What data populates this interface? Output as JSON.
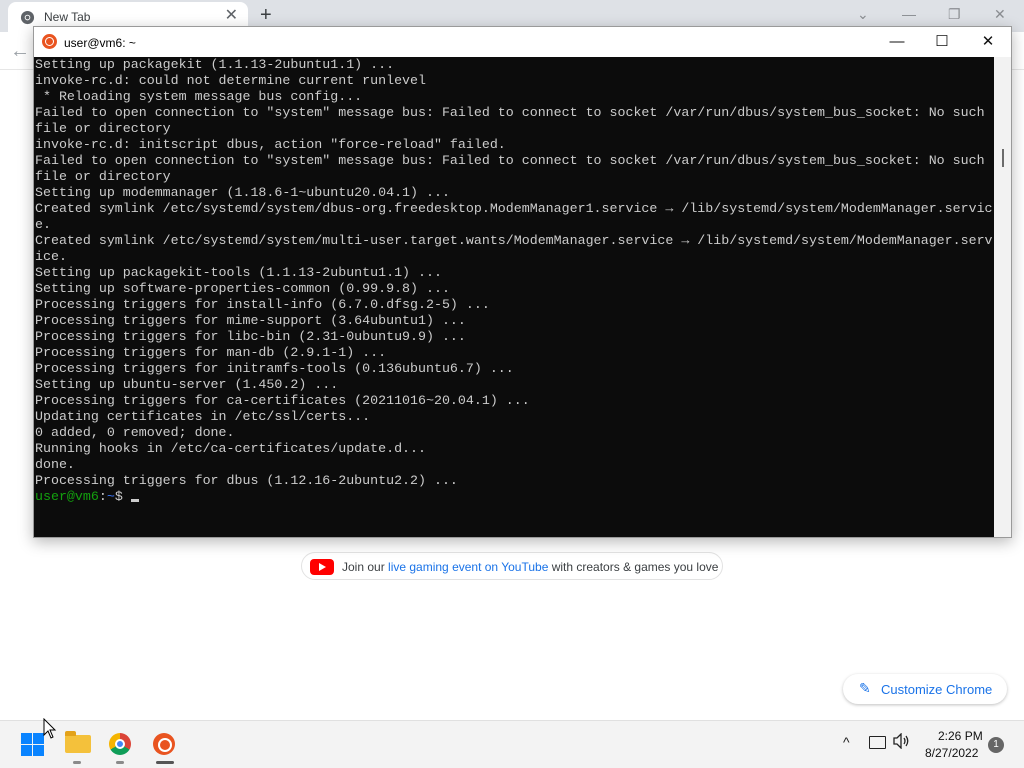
{
  "chrome": {
    "tab_title": "New Tab",
    "tab_close": "✕",
    "new_tab": "+",
    "controls": {
      "tabsearch": "⌄",
      "minimize": "—",
      "restore": "❐",
      "close": "✕"
    },
    "back": "←",
    "promo": {
      "prefix": "Join our ",
      "link": "live gaming event on YouTube",
      "suffix": " with creators & games you love"
    },
    "customize": {
      "icon": "✎",
      "label": "Customize Chrome"
    }
  },
  "terminal": {
    "title": "user@vm6: ~",
    "controls": {
      "minimize": "—",
      "maximize": "☐",
      "close": "✕"
    },
    "lines": [
      "Setting up packagekit (1.1.13-2ubuntu1.1) ...",
      "invoke-rc.d: could not determine current runlevel",
      " * Reloading system message bus config...",
      "Failed to open connection to \"system\" message bus: Failed to connect to socket /var/run/dbus/system_bus_socket: No such",
      "file or directory",
      "invoke-rc.d: initscript dbus, action \"force-reload\" failed.",
      "Failed to open connection to \"system\" message bus: Failed to connect to socket /var/run/dbus/system_bus_socket: No such",
      "file or directory",
      "Setting up modemmanager (1.18.6-1~ubuntu20.04.1) ...",
      "Created symlink /etc/systemd/system/dbus-org.freedesktop.ModemManager1.service → /lib/systemd/system/ModemManager.servic",
      "e.",
      "Created symlink /etc/systemd/system/multi-user.target.wants/ModemManager.service → /lib/systemd/system/ModemManager.serv",
      "ice.",
      "Setting up packagekit-tools (1.1.13-2ubuntu1.1) ...",
      "Setting up software-properties-common (0.99.9.8) ...",
      "Processing triggers for install-info (6.7.0.dfsg.2-5) ...",
      "Processing triggers for mime-support (3.64ubuntu1) ...",
      "Processing triggers for libc-bin (2.31-0ubuntu9.9) ...",
      "Processing triggers for man-db (2.9.1-1) ...",
      "Processing triggers for initramfs-tools (0.136ubuntu6.7) ...",
      "Setting up ubuntu-server (1.450.2) ...",
      "Processing triggers for ca-certificates (20211016~20.04.1) ...",
      "Updating certificates in /etc/ssl/certs...",
      "0 added, 0 removed; done.",
      "Running hooks in /etc/ca-certificates/update.d...",
      "done.",
      "Processing triggers for dbus (1.12.16-2ubuntu2.2) ..."
    ],
    "prompt_user": "user@vm6",
    "prompt_sep": ":",
    "prompt_path": "~",
    "prompt_end": "$"
  },
  "taskbar": {
    "tray_chevron": "^",
    "volume_icon": "🔊",
    "time": "2:26 PM",
    "date": "8/27/2022",
    "notifications": "1"
  },
  "colors": {
    "terminal_bg": "#0c0c0c",
    "terminal_fg": "#cccccc",
    "prompt_green": "#13a10e",
    "prompt_blue": "#3b78ff",
    "ubuntu_orange": "#e95420",
    "chrome_blue": "#1a73e8"
  },
  "icons": [
    "chrome-icon",
    "ubuntu-icon",
    "windows-start-icon",
    "file-explorer-icon",
    "youtube-icon",
    "pencil-icon",
    "network-icon",
    "volume-icon"
  ]
}
